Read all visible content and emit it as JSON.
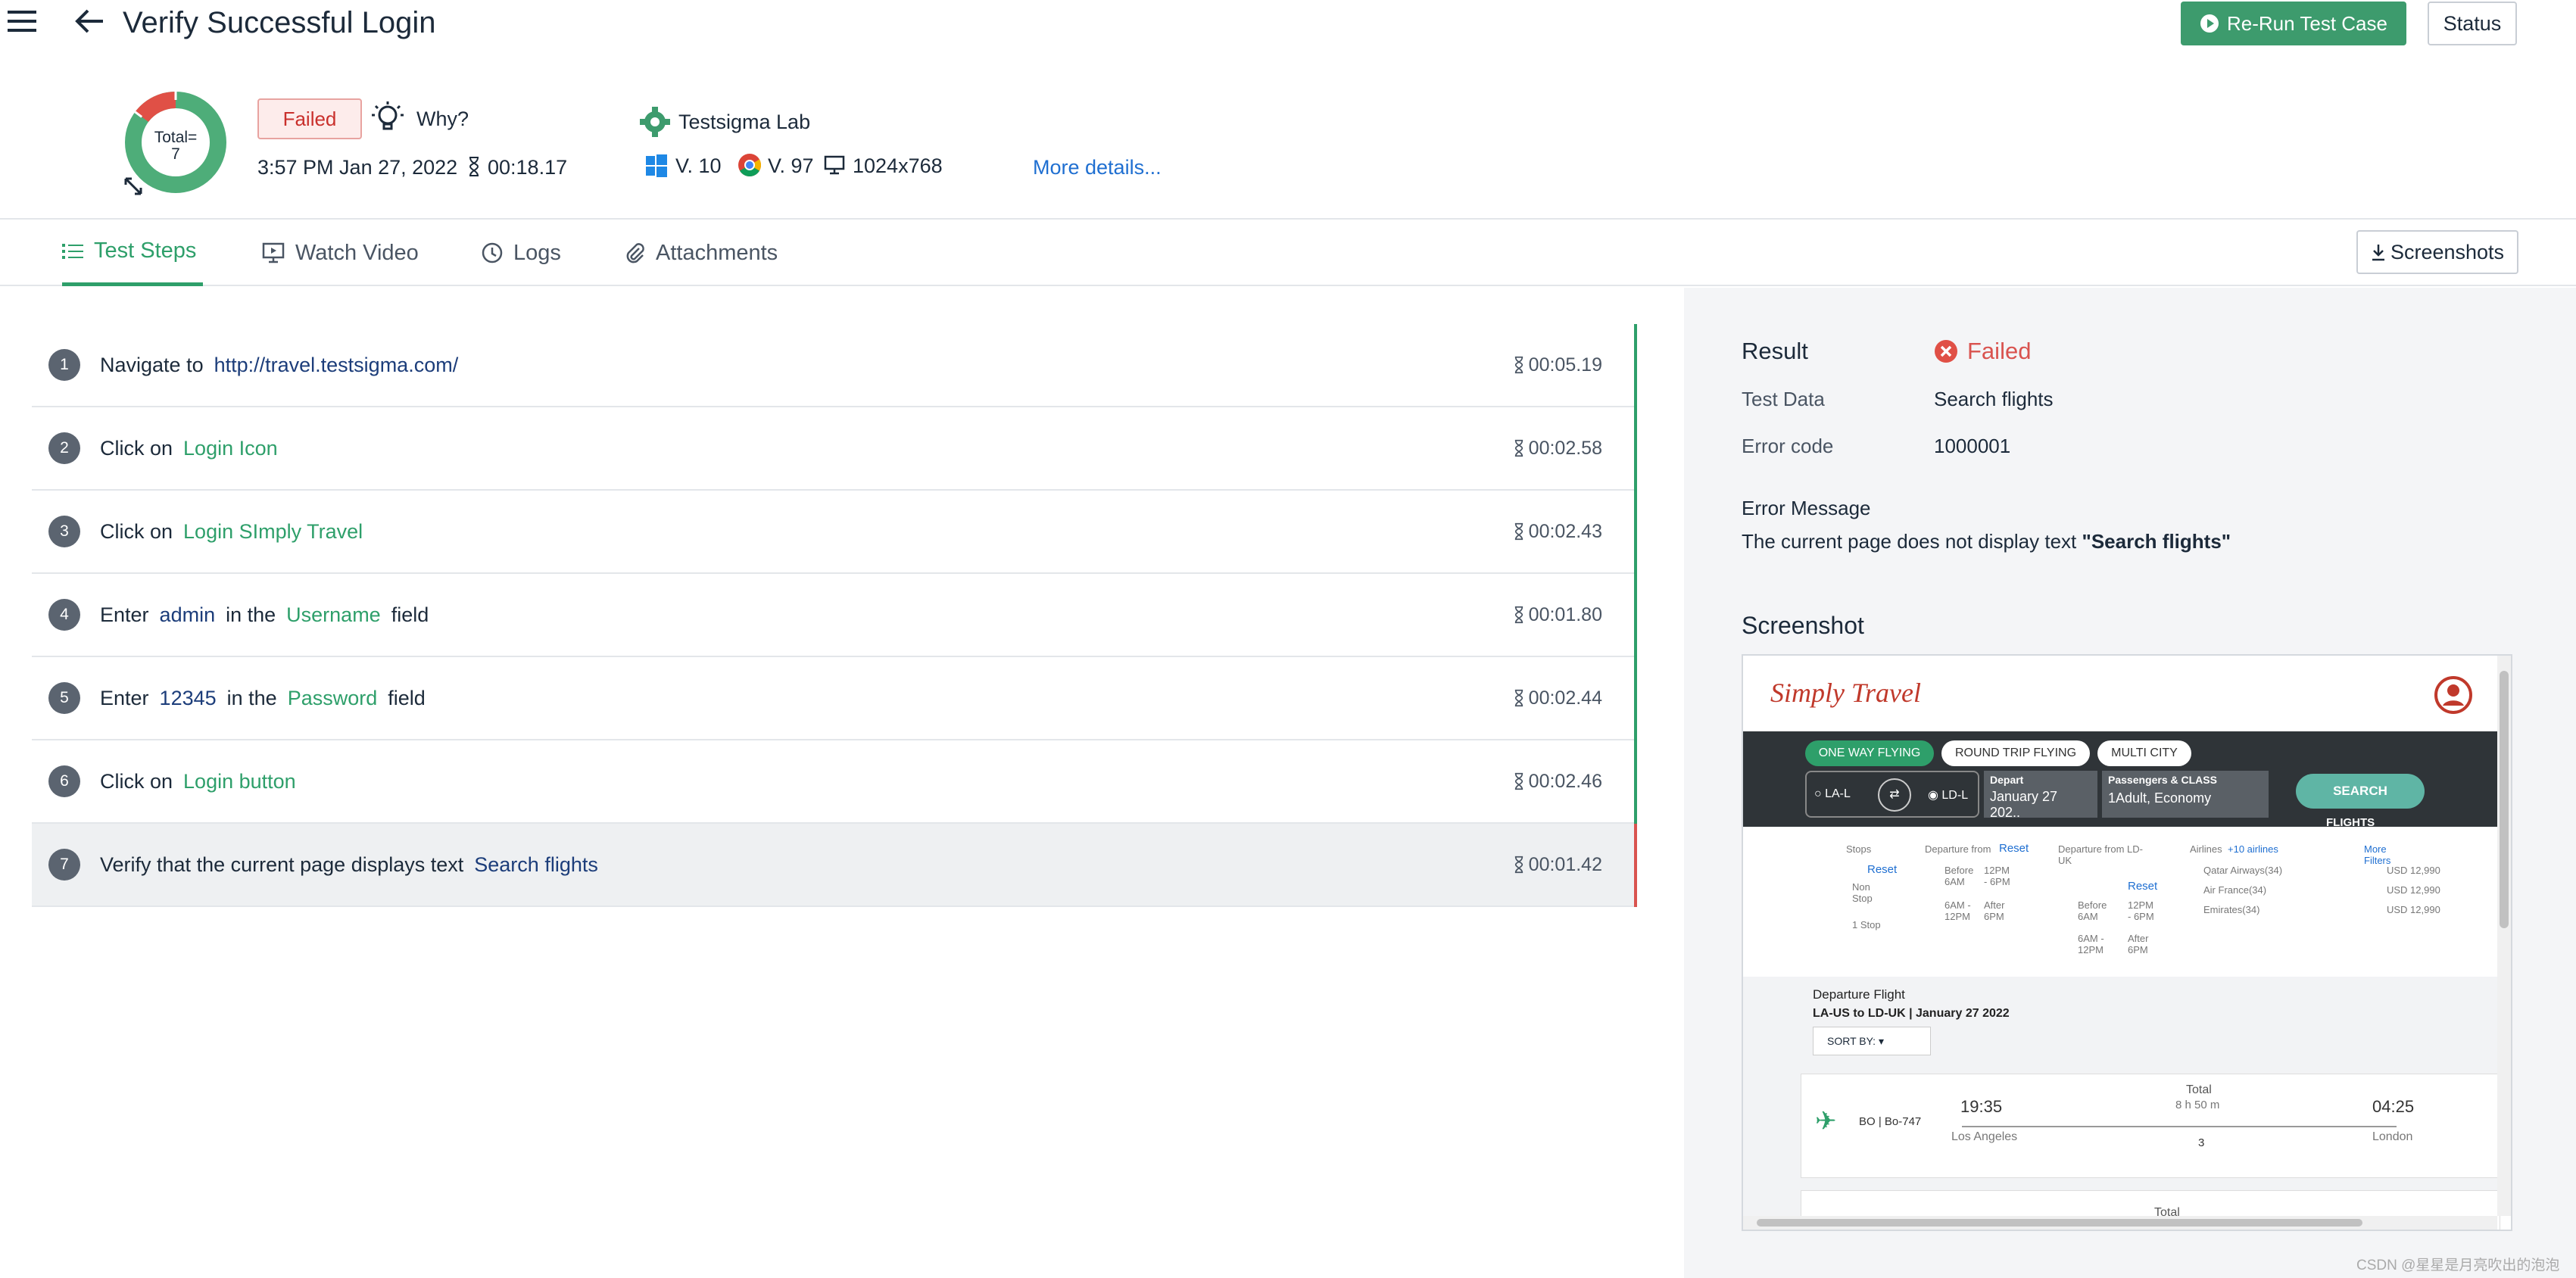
{
  "header": {
    "title": "Verify Successful Login",
    "rerun_label": "Re-Run Test Case",
    "status_label": "Status",
    "donut_label_top": "Total=",
    "donut_label_count": "7",
    "badge": "Failed",
    "why_label": "Why?",
    "datetime": "3:57 PM Jan 27, 2022",
    "duration": "00:18.17",
    "lab_name": "Testsigma Lab",
    "os_version": "V. 10",
    "browser_version": "V. 97",
    "resolution": "1024x768",
    "more_details": "More details..."
  },
  "tabs": [
    {
      "label": "Test Steps",
      "active": true
    },
    {
      "label": "Watch Video"
    },
    {
      "label": "Logs"
    },
    {
      "label": "Attachments"
    }
  ],
  "screenshots_label": "Screenshots",
  "steps": [
    {
      "num": "1",
      "parts": [
        "Navigate to",
        "http://travel.testsigma.com/"
      ],
      "duration": "00:05.19"
    },
    {
      "num": "2",
      "parts": [
        "Click on",
        "Login Icon"
      ],
      "duration": "00:02.58"
    },
    {
      "num": "3",
      "parts": [
        "Click on",
        "Login SImply Travel"
      ],
      "duration": "00:02.43"
    },
    {
      "num": "4",
      "parts": [
        "Enter",
        "admin",
        "in the",
        "Username",
        "field"
      ],
      "duration": "00:01.80"
    },
    {
      "num": "5",
      "parts": [
        "Enter",
        "12345",
        "in the",
        "Password",
        "field"
      ],
      "duration": "00:02.44"
    },
    {
      "num": "6",
      "parts": [
        "Click on",
        "Login button"
      ],
      "duration": "00:02.46"
    },
    {
      "num": "7",
      "parts": [
        "Verify that the current page displays text",
        "Search flights"
      ],
      "duration": "00:01.42"
    }
  ],
  "result": {
    "result_label": "Result",
    "result_value": "Failed",
    "test_data_label": "Test Data",
    "test_data_value": "Search flights",
    "error_code_label": "Error code",
    "error_code_value": "1000001",
    "error_message_label": "Error Message",
    "error_message_prefix": "The current page does not display text",
    "error_message_quoted": "\"Search flights\"",
    "screenshot_label": "Screenshot"
  },
  "preview": {
    "logo_left": "Simply",
    "logo_right": "Travel",
    "modes": [
      "ONE WAY FLYING",
      "ROUND TRIP FLYING",
      "MULTI CITY"
    ],
    "from": "LA-L",
    "to": "LD-L",
    "depart_label": "Depart",
    "depart_value": "January 27 202..",
    "pax_label": "Passengers & CLASS",
    "pax_value": "1Adult, Economy",
    "search": "SEARCH",
    "flights": "FLIGHTS",
    "stops": "Stops",
    "reset": "Reset",
    "nonstop": "Non Stop",
    "onestop": "1 Stop",
    "dep_from": "Departure from",
    "dep_from_ld": "Departure from LD-UK",
    "before6": "Before 6AM",
    "t12_6": "12PM - 6PM",
    "t6_12": "6AM - 12PM",
    "after6": "After 6PM",
    "airlines": "Airlines",
    "more_airlines": "+10 airlines",
    "more_filters": "More Filters",
    "airline_rows": [
      "Qatar Airways(34)",
      "Air France(34)",
      "Emirates(34)"
    ],
    "prices": [
      "USD 12,990",
      "USD 12,990",
      "USD 12,990"
    ],
    "dep_flight": "Departure Flight",
    "route": "LA-US to LD-UK | January 27 2022",
    "sort": "SORT BY:",
    "flight_code": "BO | Bo-747",
    "dep_time": "19:35",
    "dep_city": "Los Angeles",
    "total": "Total",
    "total_dur": "8 h 50 m",
    "stop_count": "3",
    "arr_time": "04:25",
    "arr_city": "London"
  },
  "watermark": "CSDN @星星是月亮吹出的泡泡",
  "colors": {
    "accent": "#2e9f6a",
    "failed": "#d9534f",
    "link": "#1f6fd1",
    "button": "#3d9b6d"
  }
}
